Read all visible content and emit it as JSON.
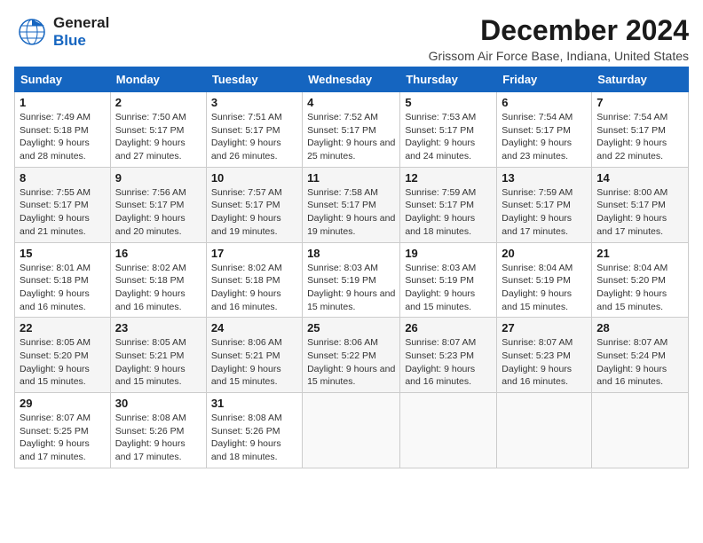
{
  "header": {
    "logo_line1": "General",
    "logo_line2": "Blue",
    "month_title": "December 2024",
    "location": "Grissom Air Force Base, Indiana, United States"
  },
  "days_of_week": [
    "Sunday",
    "Monday",
    "Tuesday",
    "Wednesday",
    "Thursday",
    "Friday",
    "Saturday"
  ],
  "weeks": [
    [
      {
        "day": "1",
        "sunrise": "7:49 AM",
        "sunset": "5:18 PM",
        "daylight": "9 hours and 28 minutes."
      },
      {
        "day": "2",
        "sunrise": "7:50 AM",
        "sunset": "5:17 PM",
        "daylight": "9 hours and 27 minutes."
      },
      {
        "day": "3",
        "sunrise": "7:51 AM",
        "sunset": "5:17 PM",
        "daylight": "9 hours and 26 minutes."
      },
      {
        "day": "4",
        "sunrise": "7:52 AM",
        "sunset": "5:17 PM",
        "daylight": "9 hours and 25 minutes."
      },
      {
        "day": "5",
        "sunrise": "7:53 AM",
        "sunset": "5:17 PM",
        "daylight": "9 hours and 24 minutes."
      },
      {
        "day": "6",
        "sunrise": "7:54 AM",
        "sunset": "5:17 PM",
        "daylight": "9 hours and 23 minutes."
      },
      {
        "day": "7",
        "sunrise": "7:54 AM",
        "sunset": "5:17 PM",
        "daylight": "9 hours and 22 minutes."
      }
    ],
    [
      {
        "day": "8",
        "sunrise": "7:55 AM",
        "sunset": "5:17 PM",
        "daylight": "9 hours and 21 minutes."
      },
      {
        "day": "9",
        "sunrise": "7:56 AM",
        "sunset": "5:17 PM",
        "daylight": "9 hours and 20 minutes."
      },
      {
        "day": "10",
        "sunrise": "7:57 AM",
        "sunset": "5:17 PM",
        "daylight": "9 hours and 19 minutes."
      },
      {
        "day": "11",
        "sunrise": "7:58 AM",
        "sunset": "5:17 PM",
        "daylight": "9 hours and 19 minutes."
      },
      {
        "day": "12",
        "sunrise": "7:59 AM",
        "sunset": "5:17 PM",
        "daylight": "9 hours and 18 minutes."
      },
      {
        "day": "13",
        "sunrise": "7:59 AM",
        "sunset": "5:17 PM",
        "daylight": "9 hours and 17 minutes."
      },
      {
        "day": "14",
        "sunrise": "8:00 AM",
        "sunset": "5:17 PM",
        "daylight": "9 hours and 17 minutes."
      }
    ],
    [
      {
        "day": "15",
        "sunrise": "8:01 AM",
        "sunset": "5:18 PM",
        "daylight": "9 hours and 16 minutes."
      },
      {
        "day": "16",
        "sunrise": "8:02 AM",
        "sunset": "5:18 PM",
        "daylight": "9 hours and 16 minutes."
      },
      {
        "day": "17",
        "sunrise": "8:02 AM",
        "sunset": "5:18 PM",
        "daylight": "9 hours and 16 minutes."
      },
      {
        "day": "18",
        "sunrise": "8:03 AM",
        "sunset": "5:19 PM",
        "daylight": "9 hours and 15 minutes."
      },
      {
        "day": "19",
        "sunrise": "8:03 AM",
        "sunset": "5:19 PM",
        "daylight": "9 hours and 15 minutes."
      },
      {
        "day": "20",
        "sunrise": "8:04 AM",
        "sunset": "5:19 PM",
        "daylight": "9 hours and 15 minutes."
      },
      {
        "day": "21",
        "sunrise": "8:04 AM",
        "sunset": "5:20 PM",
        "daylight": "9 hours and 15 minutes."
      }
    ],
    [
      {
        "day": "22",
        "sunrise": "8:05 AM",
        "sunset": "5:20 PM",
        "daylight": "9 hours and 15 minutes."
      },
      {
        "day": "23",
        "sunrise": "8:05 AM",
        "sunset": "5:21 PM",
        "daylight": "9 hours and 15 minutes."
      },
      {
        "day": "24",
        "sunrise": "8:06 AM",
        "sunset": "5:21 PM",
        "daylight": "9 hours and 15 minutes."
      },
      {
        "day": "25",
        "sunrise": "8:06 AM",
        "sunset": "5:22 PM",
        "daylight": "9 hours and 15 minutes."
      },
      {
        "day": "26",
        "sunrise": "8:07 AM",
        "sunset": "5:23 PM",
        "daylight": "9 hours and 16 minutes."
      },
      {
        "day": "27",
        "sunrise": "8:07 AM",
        "sunset": "5:23 PM",
        "daylight": "9 hours and 16 minutes."
      },
      {
        "day": "28",
        "sunrise": "8:07 AM",
        "sunset": "5:24 PM",
        "daylight": "9 hours and 16 minutes."
      }
    ],
    [
      {
        "day": "29",
        "sunrise": "8:07 AM",
        "sunset": "5:25 PM",
        "daylight": "9 hours and 17 minutes."
      },
      {
        "day": "30",
        "sunrise": "8:08 AM",
        "sunset": "5:26 PM",
        "daylight": "9 hours and 17 minutes."
      },
      {
        "day": "31",
        "sunrise": "8:08 AM",
        "sunset": "5:26 PM",
        "daylight": "9 hours and 18 minutes."
      },
      null,
      null,
      null,
      null
    ]
  ]
}
